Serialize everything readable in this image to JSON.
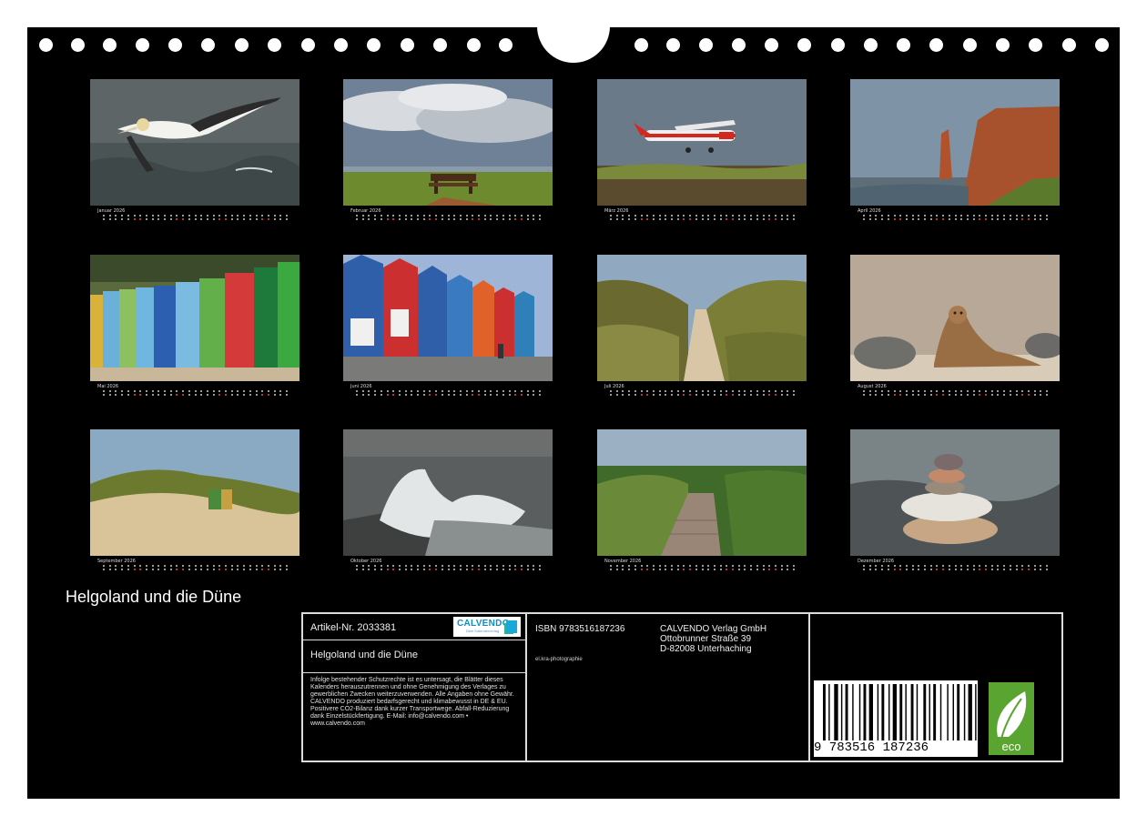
{
  "cover": {
    "title": "Helgoland und die Düne"
  },
  "months": [
    {
      "label": "Januar 2026",
      "subject": "gannet-in-flight-over-sea"
    },
    {
      "label": "Februar 2026",
      "subject": "bench-under-cloudy-sky"
    },
    {
      "label": "März 2026",
      "subject": "red-white-airplane-landing"
    },
    {
      "label": "April 2026",
      "subject": "red-sandstone-cliffs"
    },
    {
      "label": "Mai 2026",
      "subject": "colorful-beach-chairs"
    },
    {
      "label": "Juni 2026",
      "subject": "colorful-lobster-shacks"
    },
    {
      "label": "Juli 2026",
      "subject": "sandy-path-through-dunes"
    },
    {
      "label": "August 2026",
      "subject": "seals-on-beach"
    },
    {
      "label": "September 2026",
      "subject": "beach-chair-in-dune"
    },
    {
      "label": "Oktober 2026",
      "subject": "waves-crashing-on-pier"
    },
    {
      "label": "November 2026",
      "subject": "wooden-boardwalk"
    },
    {
      "label": "Dezember 2026",
      "subject": "stacked-stones"
    }
  ],
  "info": {
    "article": "Artikel-Nr. 2033381",
    "product_title": "Helgoland und die Düne",
    "legal": "Infolge bestehender Schutzrechte ist es untersagt, die Blätter dieses Kalenders herauszutrennen und ohne Genehmigung des Verlages zu gewerblichen Zwecken weiterzuverwenden. Alle Angaben ohne Gewähr. CALVENDO produziert bedarfsgerecht und klimabewusst in DE & EU. Positivere CO2-Bilanz dank kurzer Transportwege. Abfall-Reduzierung dank Einzelstückfertigung. E-Mail: info@calvendo.com • www.calvendo.com",
    "isbn": "ISBN 9783516187236",
    "photographer": "el.kra-photographie",
    "publisher_name": "CALVENDO Verlag GmbH",
    "publisher_street": "Ottobrunner Straße 39",
    "publisher_city": "D-82008 Unterhaching",
    "logo_text": "CALVENDO",
    "logo_tagline": "Dein Kalenderverlag",
    "barcode_digits": "9 783516 187236",
    "eco_label": "eco"
  },
  "colors": {
    "background": "#000000",
    "frame": "#dcdcdc",
    "eco_green": "#5aa432",
    "brand_blue": "#0b8fc2"
  }
}
